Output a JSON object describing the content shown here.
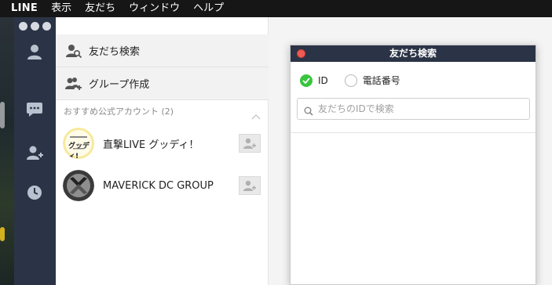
{
  "menubar": {
    "app": "LINE",
    "items": [
      "表示",
      "友だち",
      "ウィンドウ",
      "ヘルプ"
    ]
  },
  "nav": {
    "icons": [
      "person-icon",
      "chat-icon",
      "add-friend-icon",
      "clock-icon"
    ]
  },
  "left_panel": {
    "actions": [
      {
        "label": "友だち検索",
        "icon": "search-person-icon"
      },
      {
        "label": "グループ作成",
        "icon": "group-add-icon"
      }
    ],
    "section_title": "おすすめ公式アカウント (2)",
    "accounts": [
      {
        "name": "直撃LIVE グッディ！",
        "avatar_text": "グッディ!"
      },
      {
        "name": "MAVERICK DC GROUP"
      }
    ]
  },
  "dialog": {
    "title": "友だち検索",
    "radio_id": "ID",
    "radio_phone": "電話番号",
    "search_placeholder": "友だちのIDで検索"
  },
  "colors": {
    "sidebar": "#2b3446",
    "radio_on": "#39c53d",
    "close": "#ee5b55"
  }
}
